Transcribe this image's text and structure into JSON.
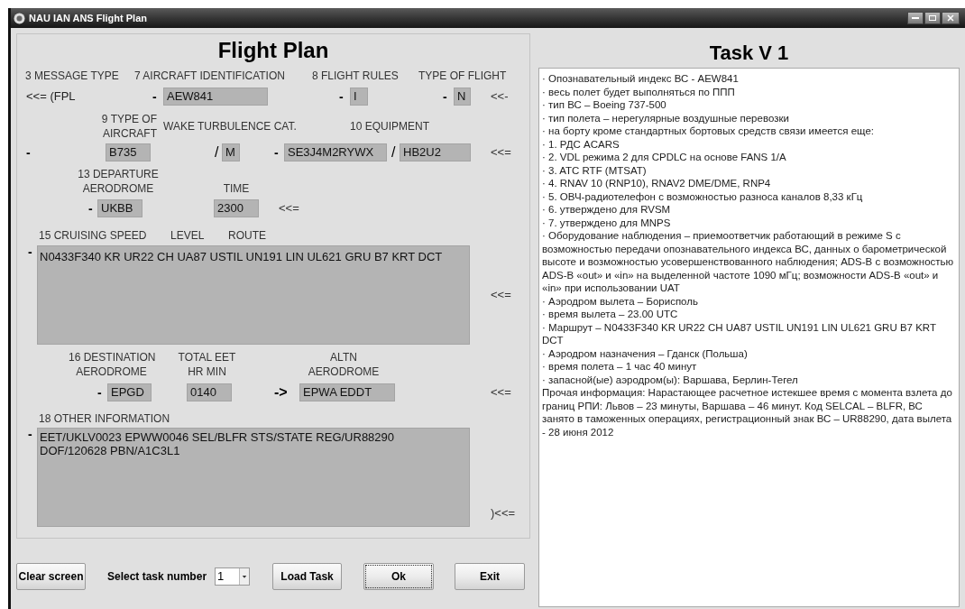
{
  "window": {
    "title": "NAU IAN ANS Flight Plan"
  },
  "form": {
    "title": "Flight Plan",
    "message_type": {
      "label": "3 MESSAGE TYPE",
      "text": "<<= (FPL"
    },
    "aircraft_id": {
      "label": "7 AIRCRAFT IDENTIFICATION",
      "dash": "-",
      "value": "AEW841"
    },
    "flight_rules": {
      "label": "8  FLIGHT RULES",
      "dash": "-",
      "value": "I"
    },
    "flight_type": {
      "label": "TYPE OF FLIGHT",
      "dash": "-",
      "value": "N"
    },
    "row1_end": "<<-",
    "aircraft_type": {
      "label_lines": [
        "9 TYPE OF",
        "AIRCRAFT"
      ],
      "dash": "-",
      "value": "B735"
    },
    "wake": {
      "label": "WAKE TURBULENCE CAT.",
      "slash": "/",
      "value": "M"
    },
    "equipment": {
      "label": "10 EQUIPMENT",
      "dash": "-",
      "value": "SE3J4M2RYWX",
      "slash": "/",
      "value2": "HB2U2"
    },
    "row2_end": "<<=",
    "departure": {
      "label_lines": [
        "13 DEPARTURE",
        "AERODROME"
      ],
      "dash": "-",
      "value": "UKBB"
    },
    "time": {
      "label": "TIME",
      "value": "2300"
    },
    "row3_end": "<<=",
    "route": {
      "labels": [
        "15 CRUISING SPEED",
        "LEVEL",
        "ROUTE"
      ],
      "dash": "-",
      "value": "N0433F340 KR UR22 CH UA87 USTIL UN191 LIN UL621 GRU B7 KRT DCT",
      "end": "<<="
    },
    "destination": {
      "label_lines": [
        "16 DESTINATION",
        "AERODROME"
      ],
      "dash": "-",
      "value": "EPGD"
    },
    "total_eet": {
      "label_lines": [
        "TOTAL EET",
        "HR MIN"
      ],
      "value": "0140"
    },
    "alternate": {
      "label_lines": [
        "ALTN",
        "AERODROME"
      ],
      "arrow": "->",
      "value": "EPWA EDDT"
    },
    "row5_end": "<<=",
    "other": {
      "label": "18 OTHER INFORMATION",
      "dash": "-",
      "lines": [
        "EET/UKLV0023 EPWW0046 SEL/BLFR STS/STATE REG/UR88290",
        "DOF/120628 PBN/A1C3L1"
      ],
      "end": ")<<="
    }
  },
  "toolbar": {
    "clear": "Clear screen",
    "select_label": "Select task number",
    "task_number": "1",
    "load": "Load Task",
    "ok": "Ok",
    "exit": "Exit"
  },
  "task": {
    "title": "Task V 1",
    "lines": [
      "· Опознавательный индекс ВС - AEW841",
      "· весь полет будет выполняться по ППП",
      "· тип ВС – Boeing 737-500",
      "· тип полета – нерегулярные воздушные перевозки",
      "· на борту кроме стандартных бортовых средств связи имеется еще:",
      "· 1. РДС ACARS",
      "· 2. VDL режима 2 для CPDLC на основе FANS 1/A",
      "· 3. ATC RTF (MTSAT)",
      "· 4. RNAV 10 (RNP10), RNAV2 DME/DME, RNP4",
      "· 5. ОВЧ-радиотелефон с возможностью разноса каналов 8,33 кГц",
      "· 6. утверждено для RVSM",
      "· 7. утверждено для MNPS",
      "· Оборудование наблюдения – приемоответчик работающий в режиме S с возможностью передачи опознавательного индекса ВС, данных о барометрической высоте и возможностью усовершенствованного наблюдения; ADS-B с возможностью ADS-B «out» и «in» на выделенной частоте 1090 мГц; возможности ADS-B «out» и «in» при использовании UAT",
      "· Аэродром вылета – Борисполь",
      "· время вылета – 23.00 UTC",
      "· Маршрут – N0433F340 KR UR22 CH UA87 USTIL UN191 LIN UL621 GRU B7 KRT DCT",
      "· Аэродром назначения – Гданск (Польша)",
      "· время полета – 1 час 40 минут",
      "· запасной(ые) аэродром(ы): Варшава, Берлин-Тегел",
      "Прочая информация: Нарастающее расчетное истекшее время с момента взлета до границ РПИ: Львов – 23 минуты, Варшава – 46 минут. Код SELCAL – BLFR, ВС занято в таможенных операциях, регистрационный знак ВС – UR88290, дата вылета  - 28 июня 2012"
    ]
  }
}
